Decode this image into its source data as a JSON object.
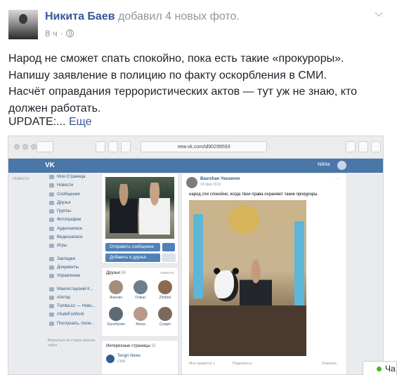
{
  "post": {
    "author": "Никита Баев",
    "action": "добавил 4 новых фото.",
    "time": "8 ч",
    "separator": "·",
    "text_lines": [
      "Народ не сможет спать спокойно, пока есть такие «прокуроры».",
      "Напишу заявление в полицию по факту оскорбления в СМИ.",
      "Насчёт оправдания террористических актов — тут уж не знаю, кто",
      "должен работать."
    ],
    "update_text": "UPDATE:...",
    "more_link": "Еще"
  },
  "screenshot": {
    "url": "new.vk.com/id90299593",
    "vk_logo": "VK",
    "user_name": "Nikita",
    "left_nav": "Новости",
    "menu": [
      "Моя Страница",
      "Новости",
      "Сообщения",
      "Друзья",
      "Группы",
      "Фотографии",
      "Аудиозаписи",
      "Видеозаписи",
      "Игры"
    ],
    "menu2": [
      "Закладки",
      "Документы",
      "Управление"
    ],
    "menu3": [
      "Мангистауский К...",
      "#Актау",
      "Tumba.kz — Ново...",
      "#SafeForWork",
      "Послушать, посм..."
    ],
    "footer_note": "Вернуться на старую версию сайта",
    "send_message": "Отправить сообщение",
    "add_friend": "Добавить в друзья",
    "friends_title": "Друзья",
    "friends_count": "86",
    "friends_link": "новости",
    "friends": [
      "Жанчин",
      "Олжас",
      "Zholdar",
      "Ерсебулан",
      "Ainisa",
      "Сундет"
    ],
    "interests_title": "Интересные страницы",
    "interests_count": "31",
    "interest_name": "Tengri News",
    "interest_sub": "СМИ",
    "wall_author": "Baurzhan Yessenov",
    "wall_date": "19 фев 2013",
    "wall_menu": "···",
    "wall_text": "народ спи спокойно, когда твои права охраняют такие прокуроры.",
    "like_label": "Мне нравится",
    "like_count": "1",
    "share_label": "Поделиться",
    "reply_label": "Ответить"
  },
  "chat": {
    "label": "Ча",
    "status_color": "#42b72a"
  },
  "colors": {
    "fb_link": "#365899",
    "vk_header": "#4a76a8",
    "vk_button": "#5181b8"
  }
}
